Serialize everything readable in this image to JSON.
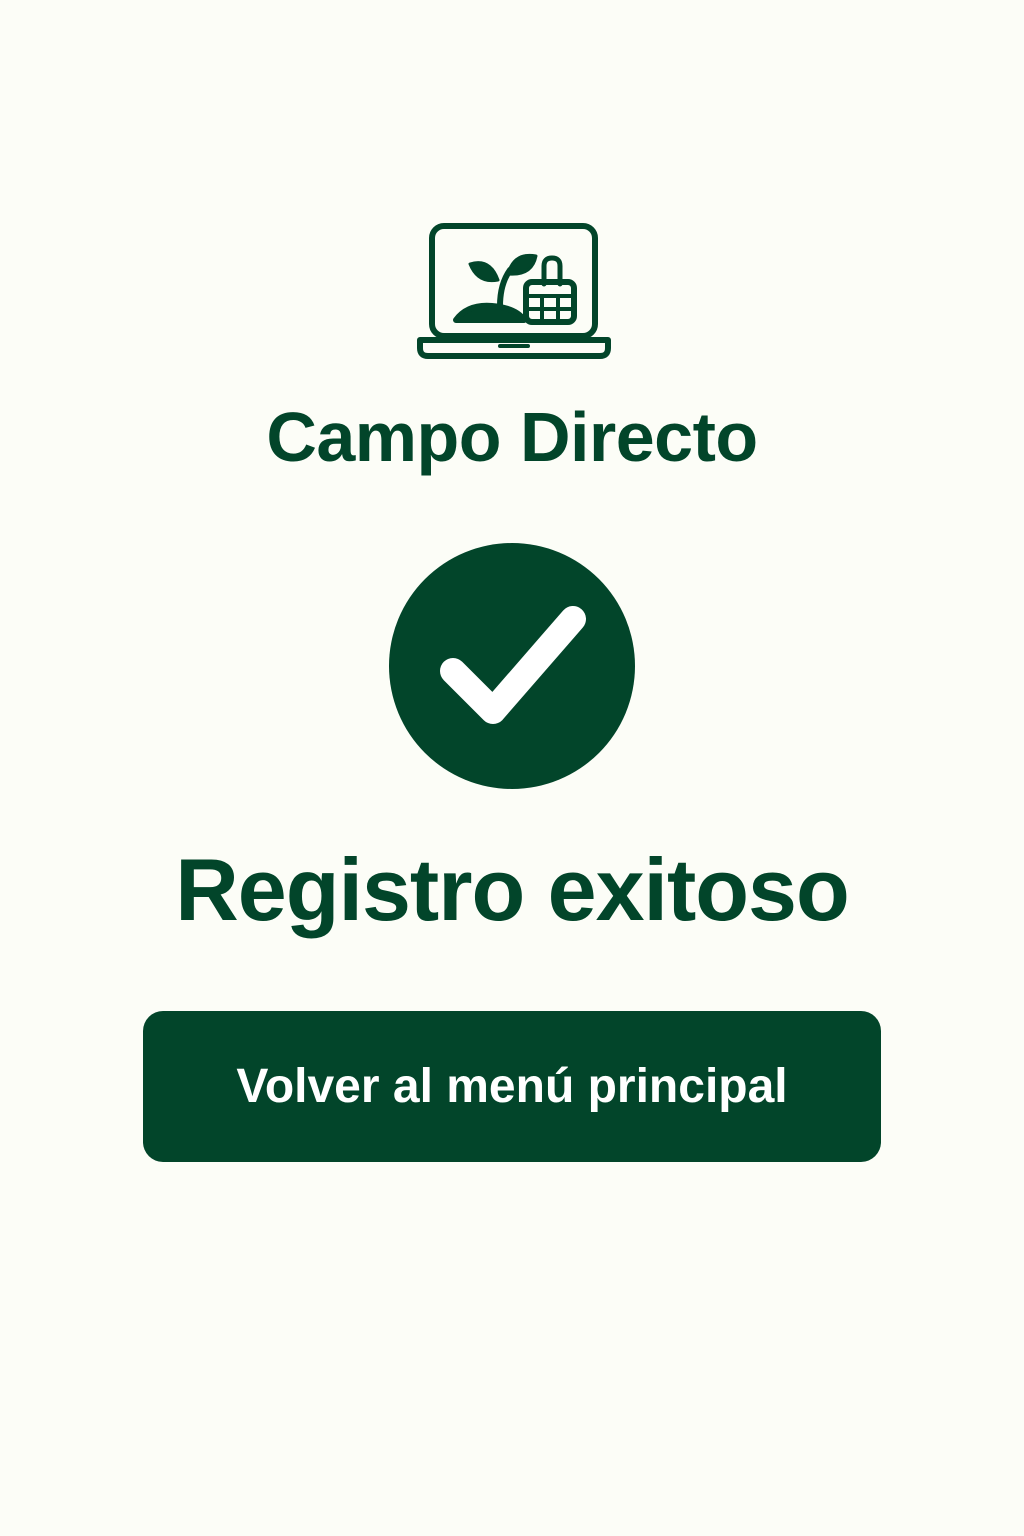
{
  "app": {
    "brand_name": "Campo Directo",
    "logo_icon": "laptop-sprout-basket-icon"
  },
  "status": {
    "icon": "check-circle-icon",
    "message": "Registro exitoso"
  },
  "actions": {
    "back_button_label": "Volver al menú principal"
  },
  "colors": {
    "primary": "#02452a",
    "background": "#fcfdf7",
    "button_text": "#ffffff"
  }
}
